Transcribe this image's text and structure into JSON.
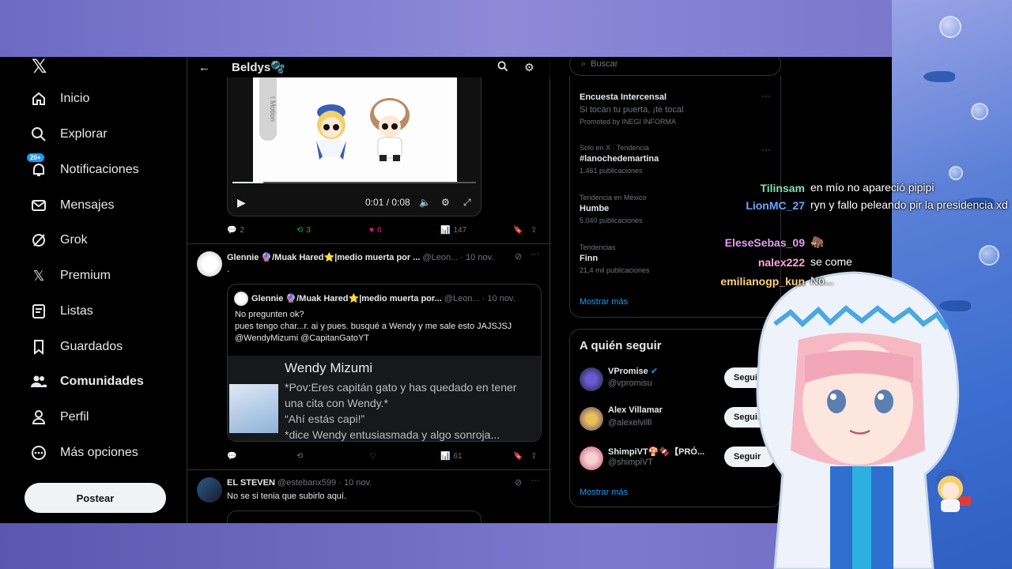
{
  "nav": {
    "logo": "𝕏",
    "items": [
      {
        "label": "Inicio"
      },
      {
        "label": "Explorar"
      },
      {
        "label": "Notificaciones",
        "badge": "20+"
      },
      {
        "label": "Mensajes"
      },
      {
        "label": "Grok"
      },
      {
        "label": "Premium"
      },
      {
        "label": "Listas"
      },
      {
        "label": "Guardados"
      },
      {
        "label": "Comunidades"
      },
      {
        "label": "Perfil"
      },
      {
        "label": "Más opciones"
      }
    ],
    "post_button": "Postear"
  },
  "timeline": {
    "title": "Beldys🫧",
    "video": {
      "side_text": "t Motion",
      "time": "0:01 / 0:08",
      "progress": 0.125
    },
    "tweet1_actions": {
      "replies": "2",
      "retweets": "3",
      "likes": "6",
      "views": "147"
    },
    "tweet2": {
      "name": "Glennie 🔮/Muak Hared⭐|medio muerta por ...",
      "handle": "@Leon...",
      "date": "· 10 nov.",
      "text": ".",
      "quote": {
        "name": "Glennie 🔮/Muak Hared⭐|medio muerta por...",
        "handle": "@Leon...",
        "date": "· 10 nov.",
        "line1": "No pregunten ok?",
        "line2": "pues tengo char...r. ai y pues. busqué a Wendy y me sale esto JAJSJSJ",
        "line3": "@WendyMizumi @CapitanGatoYT",
        "card_title": "Wendy Mizumi",
        "card_desc": "*Pov:Eres capitán gato y has quedado en tener una cita con Wendy.*\n“Ahí estás capi!”\n*dice Wendy entusiasmada y algo sonroja..."
      },
      "views": "61"
    },
    "tweet3": {
      "name": "EL STEVEN",
      "handle": "@estebanx599",
      "date": "· 10 nov.",
      "text": "No se si tenia que subirlo aquí."
    }
  },
  "right": {
    "search_placeholder": "Buscar",
    "trends": [
      {
        "cat": "",
        "name": "Encuesta Intercensal",
        "count": "Si tocan tu puerta, ¡te tocal",
        "extra": "Promoted by INEGI INFORMA"
      },
      {
        "cat": "Solo en X · Tendencia",
        "name": "#lanochedemartina",
        "count": "1.461 publicaciones"
      },
      {
        "cat": "Tendencia en México",
        "name": "Humbe",
        "count": "5.040 publicaciones"
      },
      {
        "cat": "Tendencias",
        "name": "Finn",
        "count": "21,4 mil publicaciones"
      }
    ],
    "show_more": "Mostrar más",
    "follow_title": "A quién seguir",
    "follow": [
      {
        "name": "VPromise",
        "handle": "@vpromisu",
        "btn": "Seguir"
      },
      {
        "name": "Alex Villamar",
        "handle": "@alexelvilll",
        "btn": "Seguir"
      },
      {
        "name": "ShimpiVT🍄🍫【PRÓ...",
        "handle": "@shimpiVT",
        "btn": "Seguir"
      }
    ],
    "follow_more": "Mostrar más"
  },
  "chat": [
    {
      "user": "Tilinsam",
      "color": "#7fe0b0",
      "msg": "en mío no apareció pipipi"
    },
    {
      "user": "LionMC_27",
      "color": "#6aa8ff",
      "msg": "ryn y fallo peleando pir la presidencia xd"
    },
    {
      "user": "EleseSebas_09",
      "color": "#e59cf5",
      "msg": "🦣"
    },
    {
      "user": "nalex222",
      "color": "#ffa6d6",
      "msg": "se come"
    },
    {
      "user": "emilianogp_kun",
      "color": "#ffd27a",
      "msg": "No..."
    }
  ]
}
